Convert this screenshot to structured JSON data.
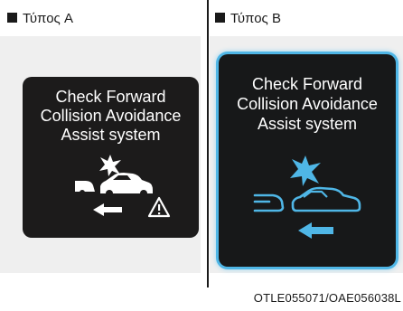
{
  "panels": {
    "left": {
      "label": "Τύπος A",
      "message": [
        "Check Forward",
        "Collision Avoidance",
        "Assist system"
      ]
    },
    "right": {
      "label": "Τύπος B",
      "message": [
        "Check Forward",
        "Collision Avoidance",
        "Assist system"
      ]
    }
  },
  "figure_code": "OTLE055071/OAE056038L",
  "colors": {
    "screen_a": "#1c1b1b",
    "screen_b": "#171819",
    "accent_b": "#4fb6e6"
  },
  "icons": {
    "left": [
      "collision-star-icon",
      "car-collision-icon",
      "warning-triangle-icon",
      "arrow-left-icon"
    ],
    "right": [
      "collision-star-icon",
      "car-collision-icon",
      "arrow-left-icon"
    ]
  }
}
